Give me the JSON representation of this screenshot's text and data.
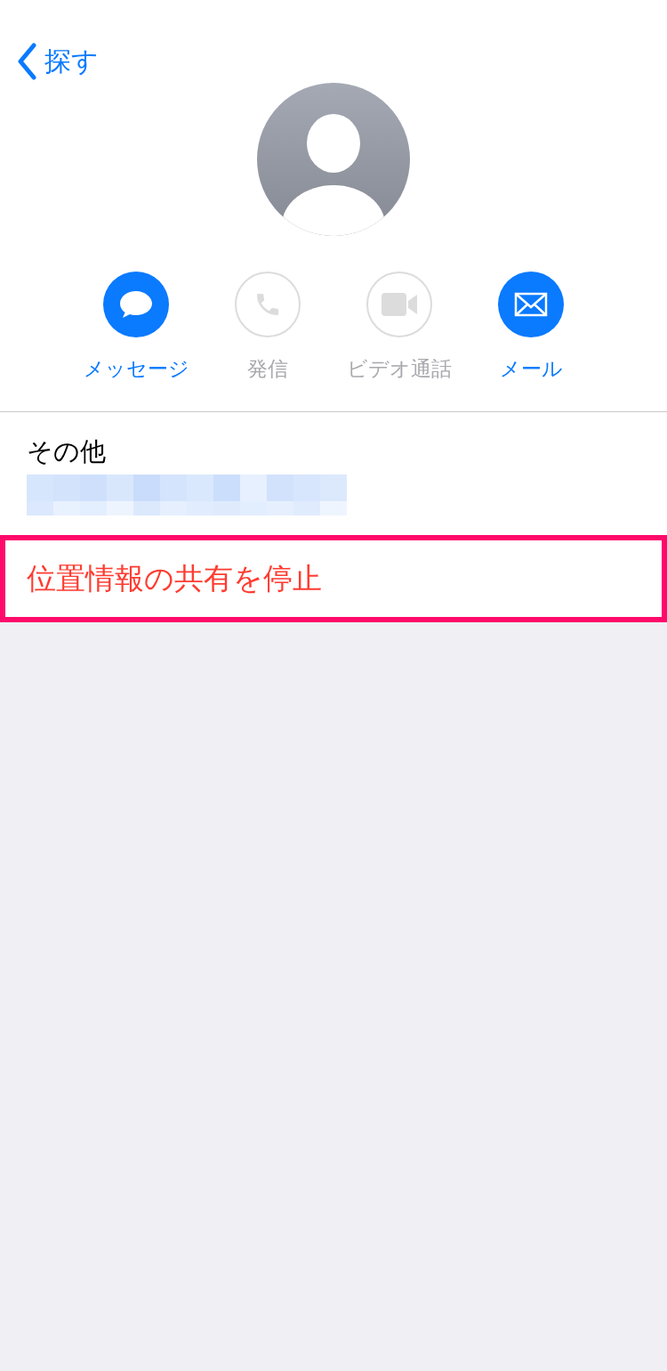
{
  "nav": {
    "back_label": "探す"
  },
  "actions": [
    {
      "kind": "message",
      "label": "メッセージ",
      "disabled": false
    },
    {
      "kind": "call",
      "label": "発信",
      "disabled": true
    },
    {
      "kind": "video",
      "label": "ビデオ通話",
      "disabled": true
    },
    {
      "kind": "mail",
      "label": "メール",
      "disabled": false
    }
  ],
  "details": {
    "label": "その他"
  },
  "stop_sharing": {
    "label": "位置情報の共有を停止",
    "highlighted": true
  }
}
